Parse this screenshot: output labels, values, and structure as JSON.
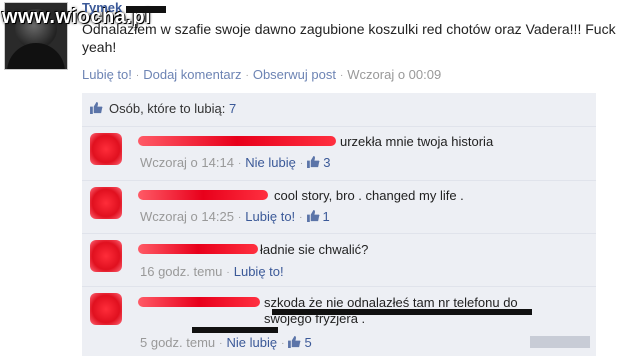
{
  "watermark": "www.wiocha.pl",
  "post": {
    "author": "Tymek",
    "text": "Odnalazłem w szafie swoje dawno zagubione koszulki red chotów oraz Vadera!!! Fuck yeah!",
    "actions": {
      "like": "Lubię to!",
      "comment": "Dodaj komentarz",
      "follow": "Obserwuj post",
      "time": "Wczoraj o 00:09"
    }
  },
  "likes": {
    "label": "Osób, które to lubią:",
    "count": "7"
  },
  "comments": [
    {
      "text": "urzekła mnie twoja historia",
      "time": "Wczoraj o 14:14",
      "action": "Nie lubię",
      "likes": "3"
    },
    {
      "text": "cool story, bro . changed my life .",
      "time": "Wczoraj o 14:25",
      "action": "Lubię to!",
      "likes": "1"
    },
    {
      "text": "ładnie sie chwalić?",
      "time": "16 godz. temu",
      "action": "Lubię to!",
      "likes": ""
    },
    {
      "text": "szkoda że nie odnalazłeś tam nr telefonu do swojego fryzjera .",
      "time": "5 godz. temu",
      "action": "Nie lubię",
      "likes": "5"
    }
  ],
  "colors": {
    "link": "#3b5998",
    "muted": "#999999",
    "panel": "#edeff4",
    "redaction": "#e8001b"
  }
}
